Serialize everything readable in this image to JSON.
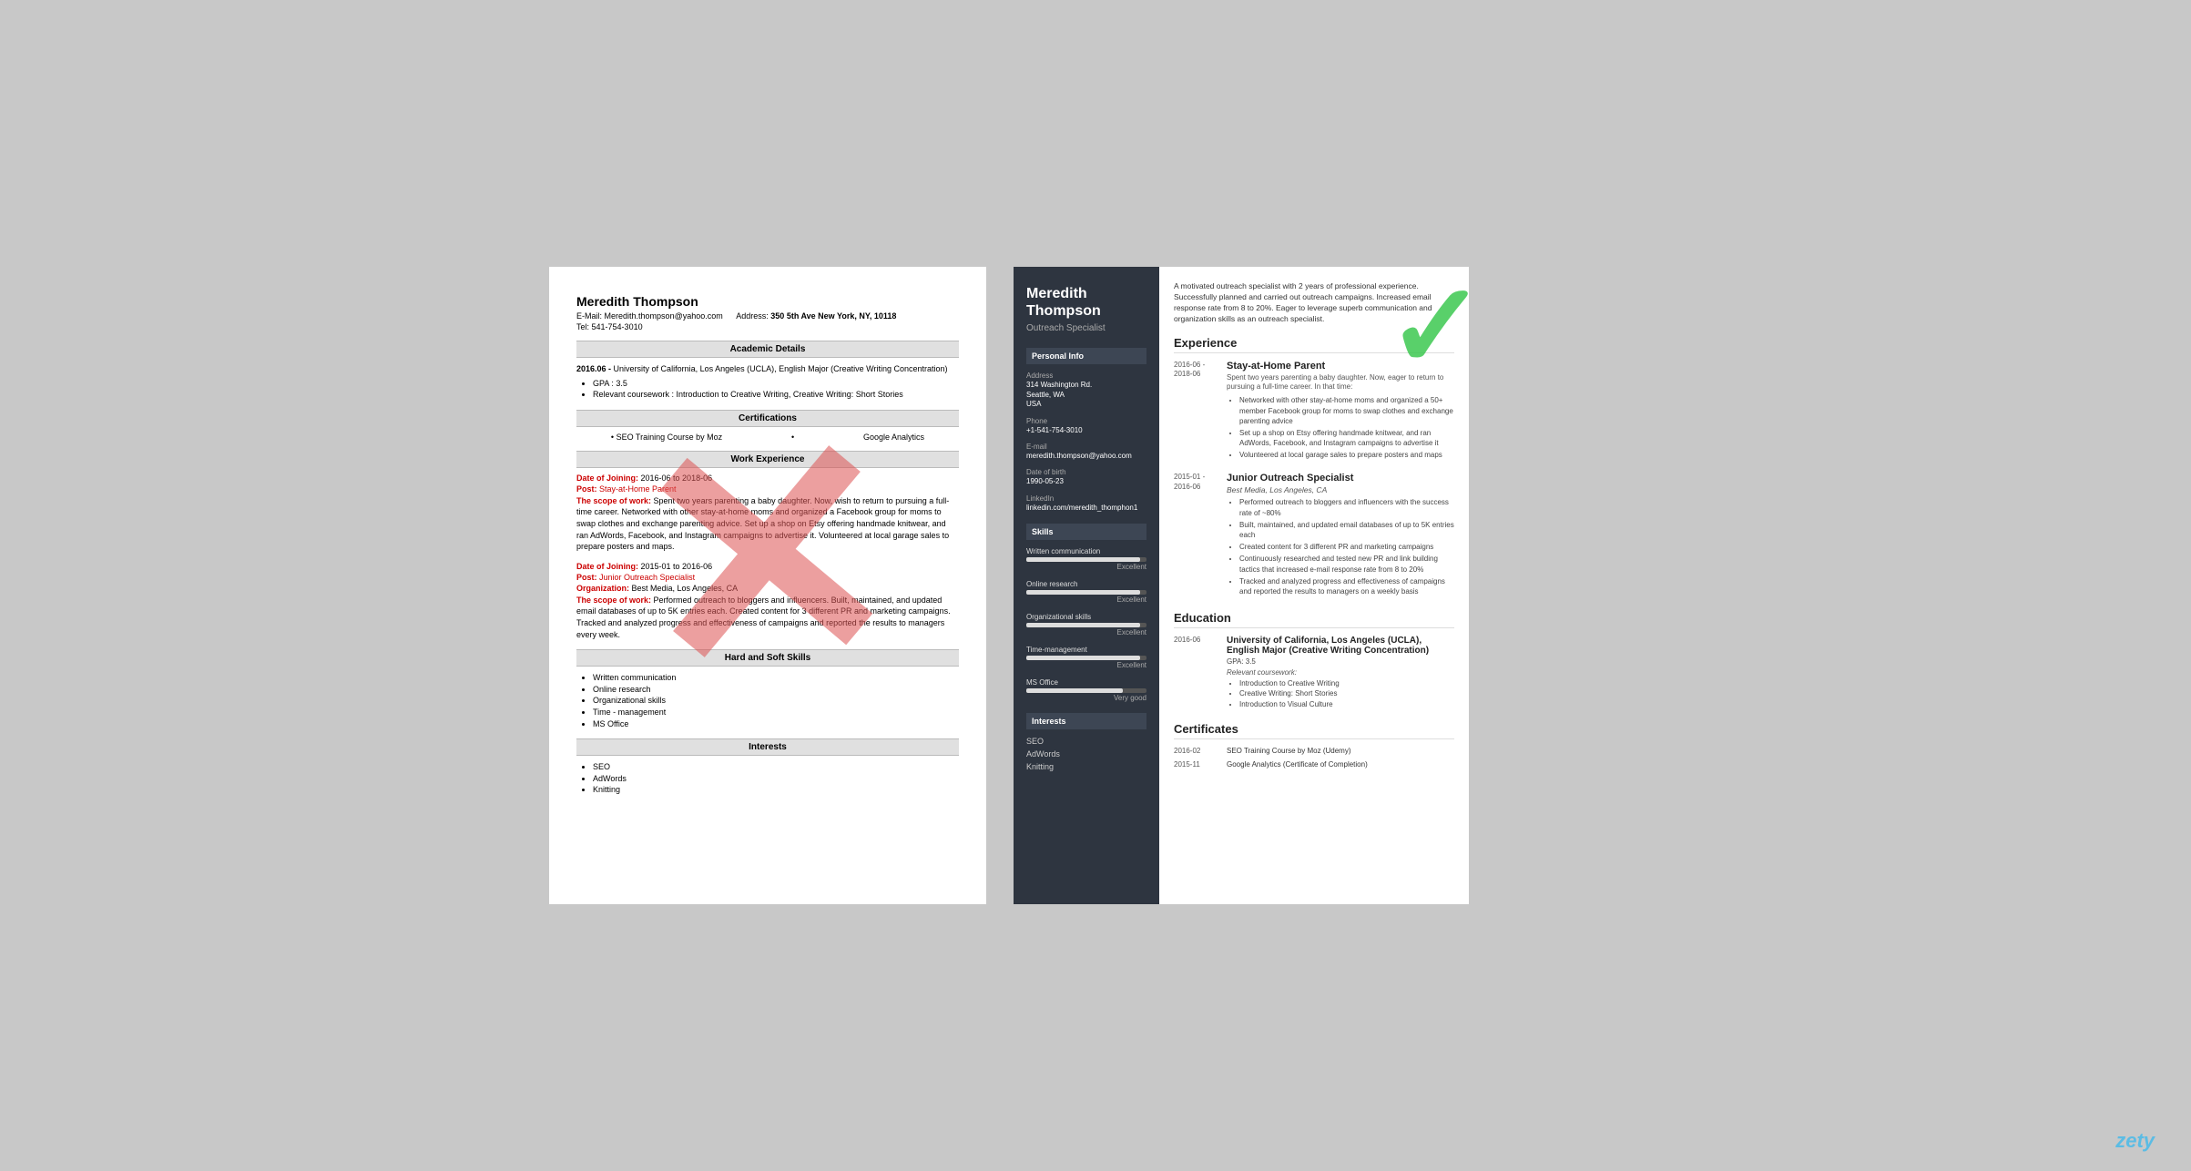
{
  "left_resume": {
    "name": "Meredith Thompson",
    "email_label": "E-Mail:",
    "email": "Meredith.thompson@yahoo.com",
    "address_label": "Address:",
    "address": "350 5th Ave New York, NY, 10118",
    "tel_label": "Tel:",
    "tel": "541-754-3010",
    "sections": {
      "academic": "Academic Details",
      "certifications": "Certifications",
      "work": "Work Experience",
      "skills": "Hard and Soft Skills",
      "interests": "Interests"
    },
    "education": {
      "date": "2016.06 -",
      "name": "University of California, Los Angeles (UCLA), English Major (Creative Writing Concentration)",
      "gpa": "GPA : 3.5",
      "coursework": "Relevant coursework : Introduction to Creative Writing, Creative Writing: Short Stories"
    },
    "certifications_list": [
      "SEO Training Course by Moz",
      "Google Analytics"
    ],
    "work_entries": [
      {
        "date_label": "Date of Joining:",
        "date": "2016-06 to 2018-06",
        "post_label": "Post:",
        "post": "Stay-at-Home Parent",
        "scope_label": "The scope of work:",
        "scope": "Spent two years parenting a baby daughter. Now, wish to return to pursuing a full-time career. Networked with other stay-at-home moms and organized a Facebook group for moms to swap clothes and exchange parenting advice. Set up a shop on Etsy offering handmade knitwear, and ran AdWords, Facebook, and Instagram campaigns to advertise it. Volunteered at local garage sales to prepare posters and maps."
      },
      {
        "date_label": "Date of Joining:",
        "date": "2015-01 to 2016-06",
        "post_label": "Post:",
        "post": "Junior Outreach Specialist",
        "org_label": "Organization:",
        "org": "Best Media, Los Angeles, CA",
        "scope_label": "The scope of work:",
        "scope": "Performed outreach to bloggers and influencers. Built, maintained, and updated email databases of up to 5K entries each. Created content for 3 different PR and marketing campaigns. Tracked and analyzed progress and effectiveness of campaigns and reported the results to managers every week."
      }
    ],
    "skills_list": [
      "Written communication",
      "Online research",
      "Organizational skills",
      "Time - management",
      "MS Office"
    ],
    "interests_list": [
      "SEO",
      "AdWords",
      "Knitting"
    ]
  },
  "right_resume": {
    "name": "Meredith Thompson",
    "title": "Outreach Specialist",
    "summary": "A motivated outreach specialist with 2 years of professional experience. Successfully planned and carried out outreach campaigns. Increased email response rate from 8 to 20%. Eager to leverage superb communication and organization skills as an outreach specialist.",
    "sidebar": {
      "personal_info_title": "Personal Info",
      "address_label": "Address",
      "address_lines": [
        "314 Washington Rd.",
        "Seattle, WA",
        "USA"
      ],
      "phone_label": "Phone",
      "phone": "+1-541-754-3010",
      "email_label": "E-mail",
      "email": "meredith.thompson@yahoo.com",
      "dob_label": "Date of birth",
      "dob": "1990-05-23",
      "linkedin_label": "LinkedIn",
      "linkedin": "linkedin.com/meredith_thomphon1",
      "skills_title": "Skills",
      "skills": [
        {
          "name": "Written communication",
          "level": "Excellent",
          "pct": 95
        },
        {
          "name": "Online research",
          "level": "Excellent",
          "pct": 95
        },
        {
          "name": "Organizational skills",
          "level": "Excellent",
          "pct": 95
        },
        {
          "name": "Time-management",
          "level": "Excellent",
          "pct": 95
        },
        {
          "name": "MS Office",
          "level": "Very good",
          "pct": 80
        }
      ],
      "interests_title": "Interests",
      "interests": [
        "SEO",
        "AdWords",
        "Knitting"
      ]
    },
    "experience_title": "Experience",
    "experience": [
      {
        "dates": "2016-06 - 2018-06",
        "title": "Stay-at-Home Parent",
        "company": "",
        "desc": "Spent two years parenting a baby daughter. Now, eager to return to pursuing a full-time career. In that time:",
        "bullets": [
          "Networked with other stay-at-home moms and organized a 50+ member Facebook group for moms to swap clothes and exchange parenting advice",
          "Set up a shop on Etsy offering handmade knitwear, and ran AdWords, Facebook, and Instagram campaigns to advertise it",
          "Volunteered at local garage sales to prepare posters and maps"
        ]
      },
      {
        "dates": "2015-01 - 2016-06",
        "title": "Junior Outreach Specialist",
        "company": "Best Media, Los Angeles, CA",
        "desc": "",
        "bullets": [
          "Performed outreach to bloggers and influencers with the success rate of ~80%",
          "Built, maintained, and updated email databases of up to 5K entries each",
          "Created content for 3 different PR and marketing campaigns",
          "Continuously researched and tested new PR and link building tactics that increased e-mail response rate from 8 to 20%",
          "Tracked and analyzed progress and effectiveness of campaigns and reported the results to managers on a weekly basis"
        ]
      }
    ],
    "education_title": "Education",
    "education": [
      {
        "date": "2016-06",
        "title": "University of California, Los Angeles (UCLA), English Major (Creative Writing Concentration)",
        "gpa": "GPA: 3.5",
        "coursework_label": "Relevant coursework:",
        "coursework": [
          "Introduction to Creative Writing",
          "Creative Writing: Short Stories",
          "Introduction to Visual Culture"
        ]
      }
    ],
    "certificates_title": "Certificates",
    "certificates": [
      {
        "date": "2016-02",
        "name": "SEO Training Course by Moz (Udemy)"
      },
      {
        "date": "2015-11",
        "name": "Google Analytics (Certificate of Completion)"
      }
    ]
  },
  "zety": "zety"
}
